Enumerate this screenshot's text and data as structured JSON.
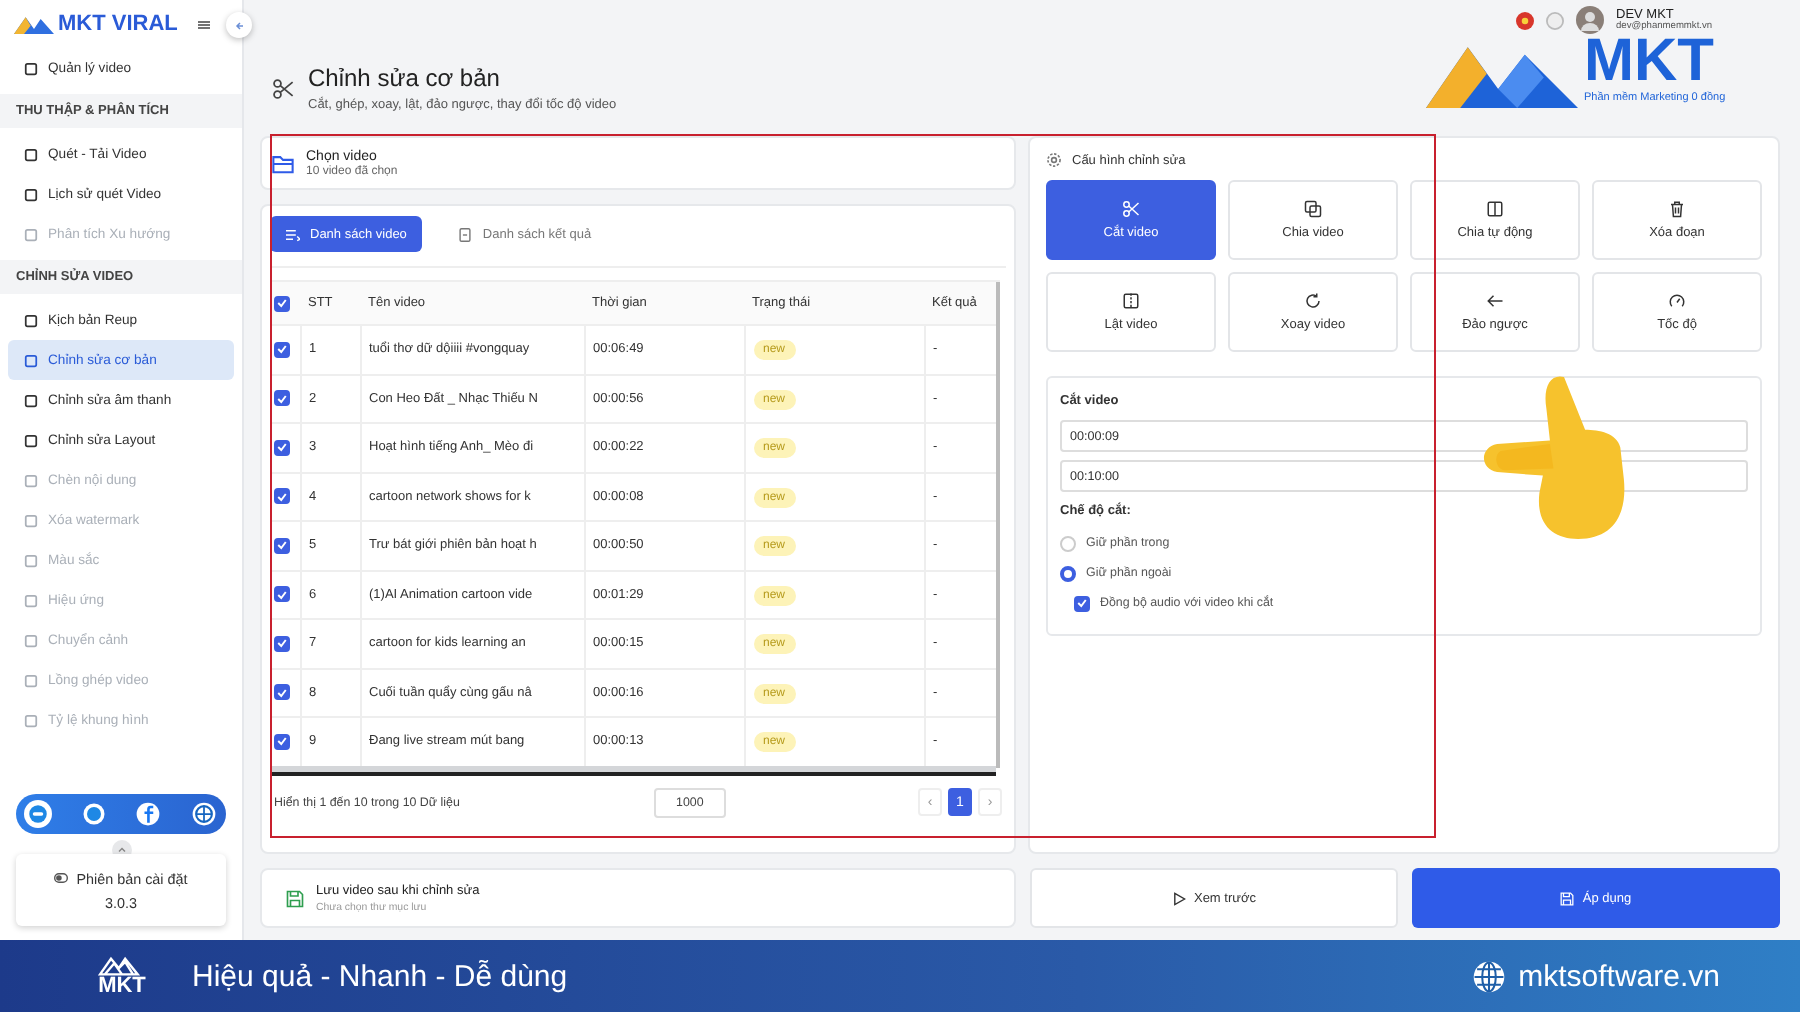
{
  "app": {
    "logo_text": "MKT VIRAL"
  },
  "user": {
    "name": "DEV MKT",
    "email": "dev@phanmemmkt.vn"
  },
  "brand": {
    "logo_text": "MKT",
    "tagline": "Phần mềm Marketing 0 đồng"
  },
  "sidebar": {
    "sections": [
      {
        "items": [
          {
            "label": "Quản lý video",
            "selected": false,
            "disabled": false
          }
        ]
      },
      {
        "heading": "THU THẬP & PHÂN TÍCH",
        "items": [
          {
            "label": "Quét - Tải Video",
            "selected": false,
            "disabled": false
          },
          {
            "label": "Lịch sử quét Video",
            "selected": false,
            "disabled": false
          },
          {
            "label": "Phân tích Xu hướng",
            "selected": false,
            "disabled": true
          }
        ]
      },
      {
        "heading": "CHỈNH SỬA VIDEO",
        "items": [
          {
            "label": "Kịch bản Reup",
            "selected": false,
            "disabled": false
          },
          {
            "label": "Chỉnh sửa cơ bản",
            "selected": true,
            "disabled": false
          },
          {
            "label": "Chỉnh sửa âm thanh",
            "selected": false,
            "disabled": false
          },
          {
            "label": "Chỉnh sửa Layout",
            "selected": false,
            "disabled": false
          },
          {
            "label": "Chèn nội dung",
            "selected": false,
            "disabled": true
          },
          {
            "label": "Xóa watermark",
            "selected": false,
            "disabled": true
          },
          {
            "label": "Màu sắc",
            "selected": false,
            "disabled": true
          },
          {
            "label": "Hiệu ứng",
            "selected": false,
            "disabled": true
          },
          {
            "label": "Chuyển cảnh",
            "selected": false,
            "disabled": true
          },
          {
            "label": "Lồng ghép video",
            "selected": false,
            "disabled": true
          },
          {
            "label": "Tỷ lệ khung hình",
            "selected": false,
            "disabled": true
          }
        ]
      }
    ],
    "version": {
      "label": "Phiên bản cài đặt",
      "number": "3.0.3"
    }
  },
  "header": {
    "title": "Chỉnh sửa cơ bản",
    "subtitle": "Cắt, ghép, xoay, lật, đảo ngược, thay đổi tốc độ video"
  },
  "video_picker": {
    "title": "Chọn video",
    "subtitle": "10 video đã chọn"
  },
  "tabs": [
    {
      "label": "Danh sách video",
      "selected": true
    },
    {
      "label": "Danh sách kết quả",
      "selected": false
    }
  ],
  "table": {
    "all_checked": true,
    "columns": [
      "STT",
      "Tên video",
      "Thời gian",
      "Trạng thái",
      "Kết quả"
    ],
    "rows": [
      {
        "checked": true,
        "cells": [
          "1",
          "tuổi thơ dữ dộiiii #vongquay",
          "00:06:49",
          "new",
          "-"
        ]
      },
      {
        "checked": true,
        "cells": [
          "2",
          "Con Heo Đất _ Nhạc Thiếu N",
          "00:00:56",
          "new",
          "-"
        ]
      },
      {
        "checked": true,
        "cells": [
          "3",
          "Hoạt hình tiếng Anh_ Mèo đi",
          "00:00:22",
          "new",
          "-"
        ]
      },
      {
        "checked": true,
        "cells": [
          "4",
          "cartoon network shows for k",
          "00:00:08",
          "new",
          "-"
        ]
      },
      {
        "checked": true,
        "cells": [
          "5",
          "Trư bát giới phiên bản hoạt h",
          "00:00:50",
          "new",
          "-"
        ]
      },
      {
        "checked": true,
        "cells": [
          "6",
          "(1)AI Animation cartoon vide",
          "00:01:29",
          "new",
          "-"
        ]
      },
      {
        "checked": true,
        "cells": [
          "7",
          "cartoon for kids learning an",
          "00:00:15",
          "new",
          "-"
        ]
      },
      {
        "checked": true,
        "cells": [
          "8",
          "Cuối tuần quẩy cùng gấu nâ",
          "00:00:16",
          "new",
          "-"
        ]
      },
      {
        "checked": true,
        "cells": [
          "9",
          "Đang live stream mút bang",
          "00:00:13",
          "new",
          "-"
        ]
      }
    ]
  },
  "pagination": {
    "summary": "Hiển thị 1 đến 10 trong 10 Dữ liệu",
    "page_size": "1000",
    "prev": "‹",
    "next": "›",
    "pages": [
      {
        "label": "1",
        "selected": true
      }
    ]
  },
  "config": {
    "title": "Cấu hình chỉnh sửa",
    "tools": [
      {
        "label": "Cắt video",
        "kind": "cut",
        "selected": true
      },
      {
        "label": "Chia video",
        "kind": "split",
        "selected": false
      },
      {
        "label": "Chia tự động",
        "kind": "autosplit",
        "selected": false
      },
      {
        "label": "Xóa đoạn",
        "kind": "delete",
        "selected": false
      },
      {
        "label": "Lật video",
        "kind": "flip",
        "selected": false
      },
      {
        "label": "Xoay video",
        "kind": "rotate",
        "selected": false
      },
      {
        "label": "Đảo ngược",
        "kind": "reverse",
        "selected": false
      },
      {
        "label": "Tốc độ",
        "kind": "speed",
        "selected": false
      }
    ],
    "cut": {
      "title": "Cắt video",
      "start": "00:00:09",
      "end": "00:10:00",
      "mode_label": "Chế độ cắt:",
      "modes": [
        {
          "label": "Giữ phần trong",
          "selected": false
        },
        {
          "label": "Giữ phần ngoài",
          "selected": true
        }
      ],
      "sync_audio": {
        "label": "Đồng bộ audio với video khi cắt",
        "checked": true
      }
    }
  },
  "save": {
    "title": "Lưu video sau khi chỉnh sửa",
    "subtitle": "Chưa chọn thư mục lưu"
  },
  "actions": {
    "preview": "Xem trước",
    "apply": "Áp dụng"
  },
  "banner": {
    "logo_text": "MKT",
    "slogan": "Hiệu quả - Nhanh - Dễ dùng",
    "website": "mktsoftware.vn"
  }
}
